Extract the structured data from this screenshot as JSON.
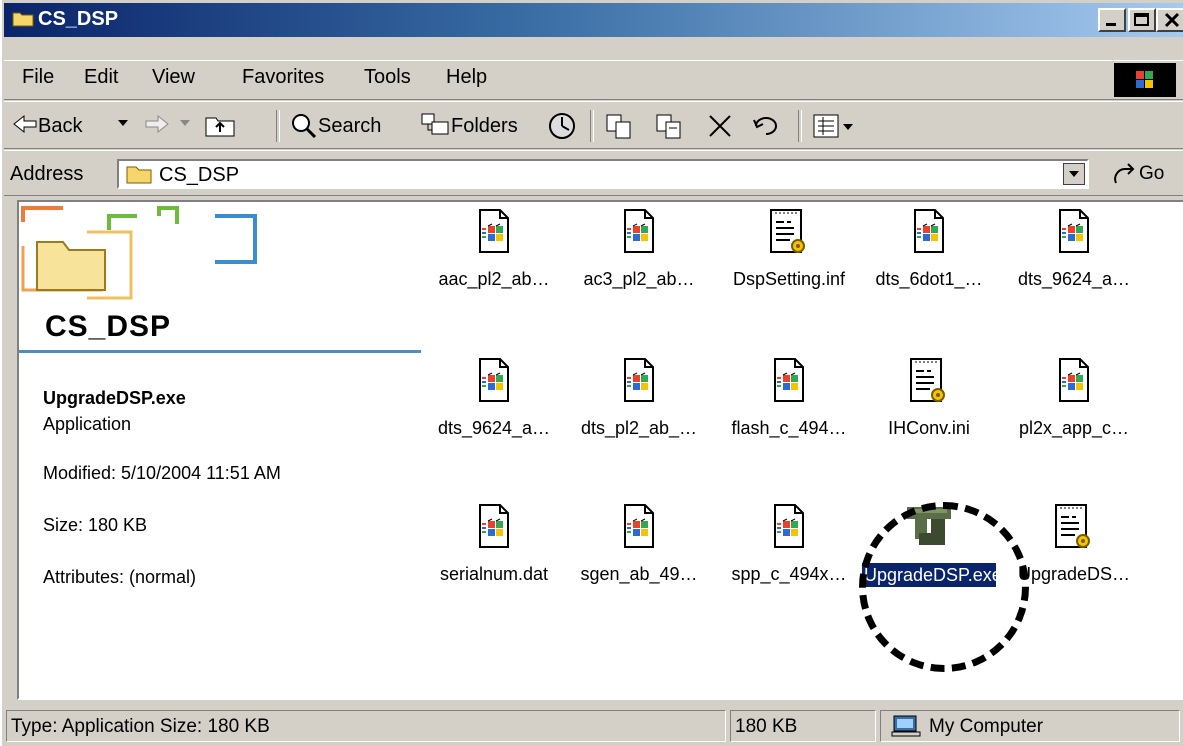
{
  "window": {
    "title": "CS_DSP"
  },
  "menu": [
    "File",
    "Edit",
    "View",
    "Favorites",
    "Tools",
    "Help"
  ],
  "toolbar": {
    "back": "Back",
    "search": "Search",
    "folders": "Folders"
  },
  "address": {
    "label": "Address",
    "value": "CS_DSP",
    "go": "Go"
  },
  "left_pane": {
    "folder_name": "CS_DSP",
    "selected_name": "UpgradeDSP.exe",
    "selected_type": "Application",
    "modified": "Modified: 5/10/2004 11:51 AM",
    "size": "Size: 180 KB",
    "attributes": "Attributes: (normal)"
  },
  "files": [
    {
      "name": "aac_pl2_ab…",
      "icon": "windows-file-icon"
    },
    {
      "name": "ac3_pl2_ab…",
      "icon": "windows-file-icon"
    },
    {
      "name": "DspSetting.inf",
      "icon": "settings-file-icon"
    },
    {
      "name": "dts_6dot1_…",
      "icon": "windows-file-icon"
    },
    {
      "name": "dts_9624_a…",
      "icon": "windows-file-icon"
    },
    {
      "name": "dts_9624_a…",
      "icon": "windows-file-icon"
    },
    {
      "name": "dts_pl2_ab_…",
      "icon": "windows-file-icon"
    },
    {
      "name": "flash_c_494…",
      "icon": "windows-file-icon"
    },
    {
      "name": "IHConv.ini",
      "icon": "settings-file-icon"
    },
    {
      "name": "pl2x_app_c…",
      "icon": "windows-file-icon"
    },
    {
      "name": "serialnum.dat",
      "icon": "windows-file-icon"
    },
    {
      "name": "sgen_ab_49…",
      "icon": "windows-file-icon"
    },
    {
      "name": "spp_c_494x…",
      "icon": "windows-file-icon"
    },
    {
      "name": "UpgradeDSP.exe",
      "icon": "application-icon",
      "selected": true
    },
    {
      "name": "UpgradeDS…",
      "icon": "settings-file-icon"
    }
  ],
  "status": {
    "info": "Type: Application Size: 180 KB",
    "size": "180 KB",
    "zone": "My Computer"
  }
}
